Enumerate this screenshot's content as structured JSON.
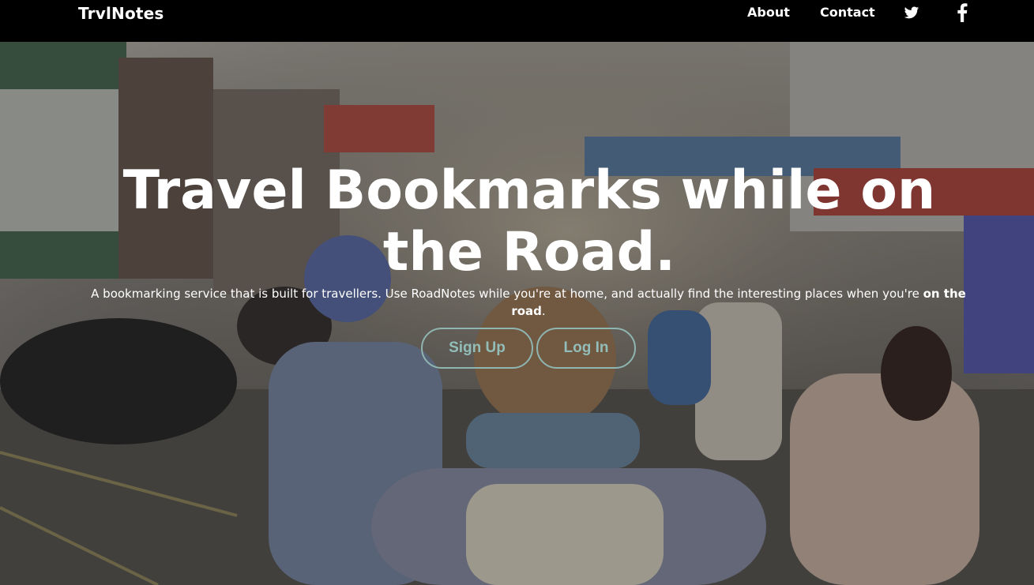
{
  "nav": {
    "brand": "TrvlNotes",
    "about": "About",
    "contact": "Contact",
    "twitter_icon": "twitter-icon",
    "facebook_icon": "facebook-icon"
  },
  "hero": {
    "title": "Travel Bookmarks while on the Road.",
    "subtitle_prefix": "A bookmarking service that is built for travellers. Use RoadNotes while you're at home, and actually find the interesting places when you're ",
    "subtitle_emphasis": "on the road",
    "subtitle_suffix": ".",
    "signup_label": "Sign Up",
    "login_label": "Log In"
  },
  "colors": {
    "navbar": "#000000",
    "button_border": "#8fb5b1",
    "button_text": "#93bdb8",
    "hero_text": "#ffffff"
  }
}
